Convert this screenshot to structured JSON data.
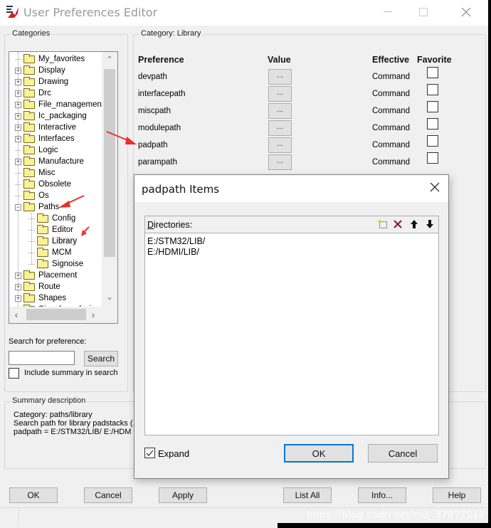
{
  "window": {
    "title": "User Preferences Editor",
    "icon": "allegro-app-icon",
    "controls": [
      "minimize",
      "maximize",
      "close"
    ]
  },
  "categories": {
    "group_label": "Categories",
    "tree": [
      {
        "label": "My_favorites",
        "expander": "none",
        "level": 0
      },
      {
        "label": "Display",
        "expander": "plus",
        "level": 0
      },
      {
        "label": "Drawing",
        "expander": "plus",
        "level": 0
      },
      {
        "label": "Drc",
        "expander": "plus",
        "level": 0
      },
      {
        "label": "File_management",
        "expander": "plus",
        "level": 0
      },
      {
        "label": "Ic_packaging",
        "expander": "plus",
        "level": 0
      },
      {
        "label": "Interactive",
        "expander": "plus",
        "level": 0
      },
      {
        "label": "Interfaces",
        "expander": "plus",
        "level": 0
      },
      {
        "label": "Logic",
        "expander": "none",
        "level": 0
      },
      {
        "label": "Manufacture",
        "expander": "plus",
        "level": 0
      },
      {
        "label": "Misc",
        "expander": "none",
        "level": 0
      },
      {
        "label": "Obsolete",
        "expander": "none",
        "level": 0
      },
      {
        "label": "Os",
        "expander": "none",
        "level": 0
      },
      {
        "label": "Paths",
        "expander": "minus",
        "level": 0
      },
      {
        "label": "Config",
        "expander": "none",
        "level": 1
      },
      {
        "label": "Editor",
        "expander": "none",
        "level": 1
      },
      {
        "label": "Library",
        "expander": "none",
        "level": 1,
        "selected": true
      },
      {
        "label": "MCM",
        "expander": "none",
        "level": 1
      },
      {
        "label": "Signoise",
        "expander": "none",
        "level": 1
      },
      {
        "label": "Placement",
        "expander": "plus",
        "level": 0
      },
      {
        "label": "Route",
        "expander": "plus",
        "level": 0
      },
      {
        "label": "Shapes",
        "expander": "plus",
        "level": 0
      },
      {
        "label": "Signal_analysis",
        "expander": "none",
        "level": 0
      }
    ],
    "search_label": "Search for preference:",
    "search_value": "",
    "search_button": "Search",
    "include_summary_label": "Include summary in search",
    "include_summary_checked": false
  },
  "preferences": {
    "group_label": "Category:  Library",
    "columns": [
      "Preference",
      "Value",
      "Effective",
      "Favorite"
    ],
    "rows": [
      {
        "name": "devpath",
        "value_button": "...",
        "effective": "Command",
        "favorite": false
      },
      {
        "name": "interfacepath",
        "value_button": "...",
        "effective": "Command",
        "favorite": false
      },
      {
        "name": "miscpath",
        "value_button": "...",
        "effective": "Command",
        "favorite": false
      },
      {
        "name": "modulepath",
        "value_button": "...",
        "effective": "Command",
        "favorite": false
      },
      {
        "name": "padpath",
        "value_button": "...",
        "effective": "Command",
        "favorite": false
      },
      {
        "name": "parampath",
        "value_button": "...",
        "effective": "Command",
        "favorite": false
      }
    ]
  },
  "summary": {
    "group_label": "Summary description",
    "lines": [
      "Category: paths/library",
      "Search path for library padstacks (.p",
      "padpath = E:/STM32/LIB/ E:/HDM"
    ]
  },
  "bottom_buttons": [
    "OK",
    "Cancel",
    "Apply",
    "List All",
    "Info...",
    "Help"
  ],
  "watermark": "https://blog.csdn.net/m0_37872216",
  "dialog": {
    "title": "padpath Items",
    "directories_label": "Directories:",
    "toolbar": [
      "new-item-icon",
      "delete-icon",
      "move-up-icon",
      "move-down-icon"
    ],
    "items": [
      "E:/STM32/LIB/",
      "E:/HDMI/LIB/"
    ],
    "expand_label": "Expand",
    "expand_checked": true,
    "ok": "OK",
    "cancel": "Cancel"
  },
  "colors": {
    "accent": "#0078d7",
    "annotation_arrow": "#e8302a",
    "folder": "#f8f198",
    "delete_icon": "#8b1a1a"
  }
}
